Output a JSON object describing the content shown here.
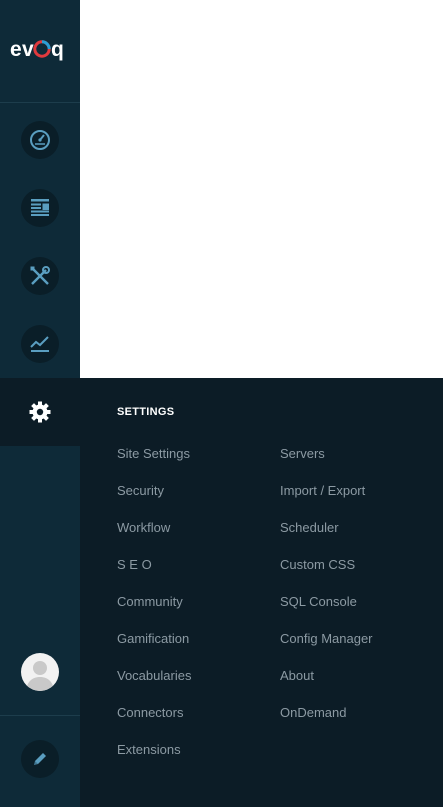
{
  "app": {
    "logo_text": "evoq"
  },
  "sidebar": {
    "items": [
      {
        "id": "dashboard",
        "icon": "gauge-icon"
      },
      {
        "id": "content",
        "icon": "content-icon"
      },
      {
        "id": "tools",
        "icon": "tools-icon"
      },
      {
        "id": "analytics",
        "icon": "chart-icon"
      },
      {
        "id": "settings",
        "icon": "gear-icon",
        "active": true
      }
    ],
    "bottom": [
      {
        "id": "profile",
        "icon": "avatar-icon"
      },
      {
        "id": "edit",
        "icon": "pencil-icon"
      }
    ]
  },
  "settings_menu": {
    "title": "SETTINGS",
    "left": [
      "Site Settings",
      "Security",
      "Workflow",
      "S E O",
      "Community",
      "Gamification",
      "Vocabularies",
      "Connectors",
      "Extensions"
    ],
    "right": [
      "Servers",
      "Import / Export",
      "Scheduler",
      "Custom CSS",
      "SQL Console",
      "Config Manager",
      "About",
      "OnDemand"
    ]
  },
  "colors": {
    "sidebar_bg": "#0e2a38",
    "flyout_bg": "#0c1c26",
    "icon_blue": "#5a9ec0",
    "menu_text": "#8c9aa3",
    "logo_red": "#e03a3e",
    "logo_blue": "#2a9fd6"
  }
}
